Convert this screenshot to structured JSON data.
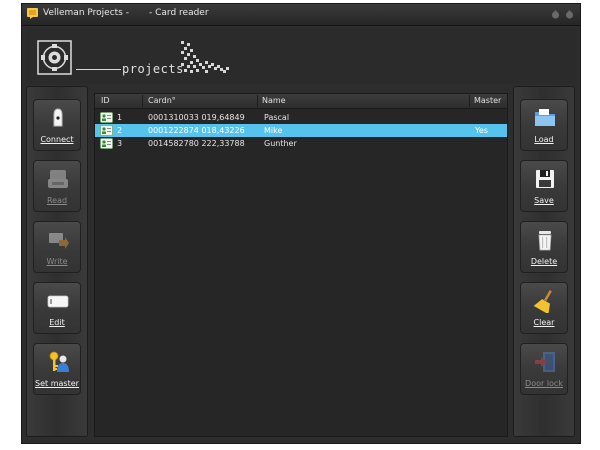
{
  "window": {
    "app_title": "Velleman Projects -",
    "sub_title": "- Card reader"
  },
  "banner": {
    "logo_text": "projects"
  },
  "left_toolbar": [
    {
      "label": "Connect",
      "icon": "door-bell-icon",
      "enabled": true
    },
    {
      "label": "Read",
      "icon": "card-reader-icon",
      "enabled": false
    },
    {
      "label": "Write",
      "icon": "write-card-icon",
      "enabled": false
    },
    {
      "label": "Edit",
      "icon": "card-icon",
      "enabled": true
    },
    {
      "label": "Set master",
      "icon": "key-user-icon",
      "enabled": true
    }
  ],
  "right_toolbar": [
    {
      "label": "Load",
      "icon": "folder-icon",
      "enabled": true
    },
    {
      "label": "Save",
      "icon": "floppy-disk-icon",
      "enabled": true
    },
    {
      "label": "Delete",
      "icon": "trash-can-icon",
      "enabled": true
    },
    {
      "label": "Clear",
      "icon": "broom-icon",
      "enabled": true
    },
    {
      "label": "Door lock",
      "icon": "door-exit-icon",
      "enabled": false
    }
  ],
  "table": {
    "columns": [
      "ID",
      "Cardn°",
      "Name",
      "Master"
    ],
    "rows": [
      {
        "id": "1",
        "card": "0001310033 019,64849",
        "name": "Pascal",
        "master": "",
        "selected": false
      },
      {
        "id": "2",
        "card": "0001222874 018,43226",
        "name": "Mike",
        "master": "Yes",
        "selected": true
      },
      {
        "id": "3",
        "card": "0014582780 222,33788",
        "name": "Gunther",
        "master": "",
        "selected": false
      }
    ]
  },
  "colors": {
    "selection": "#56c3ee",
    "background": "#2d2d2d"
  }
}
